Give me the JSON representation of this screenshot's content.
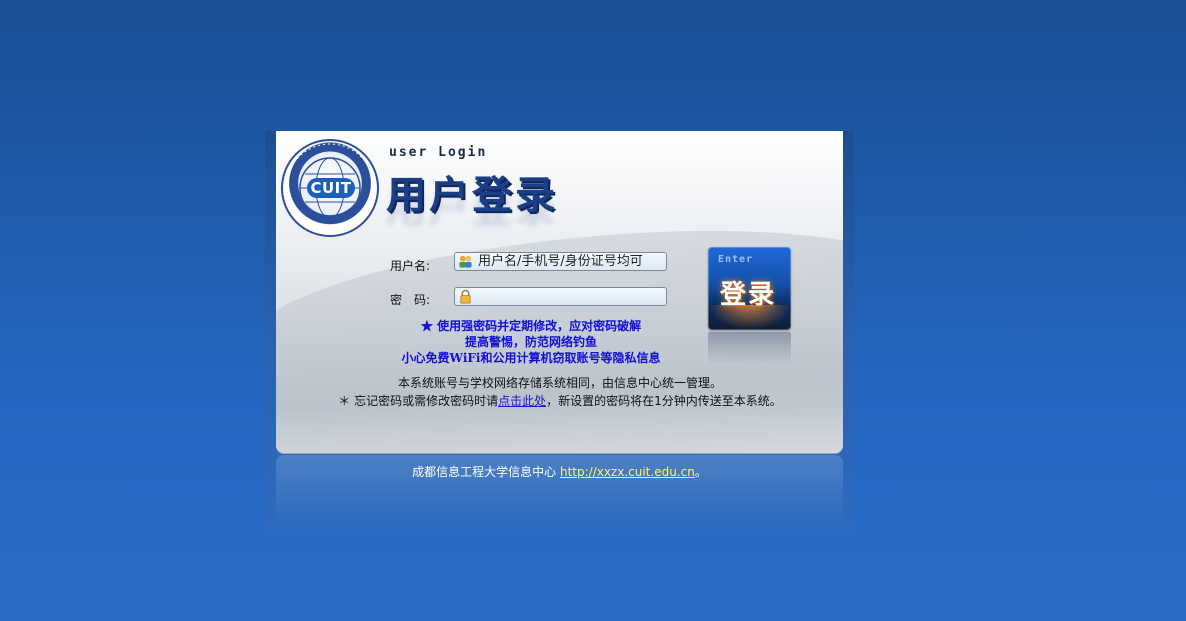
{
  "logo": {
    "abbr": "CUIT",
    "icon": "university-seal-icon"
  },
  "header": {
    "title_en": "user Login",
    "title_cn": "用户登录"
  },
  "form": {
    "username_label": "用户名:",
    "username_placeholder": "用户名/手机号/身份证号均可",
    "password_label": "密　码:",
    "password_value": "",
    "username_icon": "users-icon",
    "password_icon": "lock-icon"
  },
  "login_button": {
    "label_en": "Enter",
    "label_cn": "登录"
  },
  "notice": {
    "line1": "★ 使用强密码并定期修改，应对密码破解",
    "line2": "提高警惕，防范网络钓鱼",
    "line3": "小心免费WiFi和公用计算机窃取账号等隐私信息"
  },
  "info": {
    "line1": "本系统账号与学校网络存储系统相同，由信息中心统一管理。",
    "line2_prefix": "＊ 忘记密码或需修改密码时请",
    "line2_link": "点击此处",
    "line2_suffix": "，新设置的密码将在1分钟内传送至本系统。"
  },
  "footer": {
    "text": "成都信息工程大学信息中心 ",
    "link": "http://xxzx.cuit.edu.cn",
    "suffix": "。"
  },
  "colors": {
    "background": "#1f5dab",
    "notice_text": "#1010d6",
    "link": "#1a14c4",
    "footer_link": "#fffa5a"
  }
}
